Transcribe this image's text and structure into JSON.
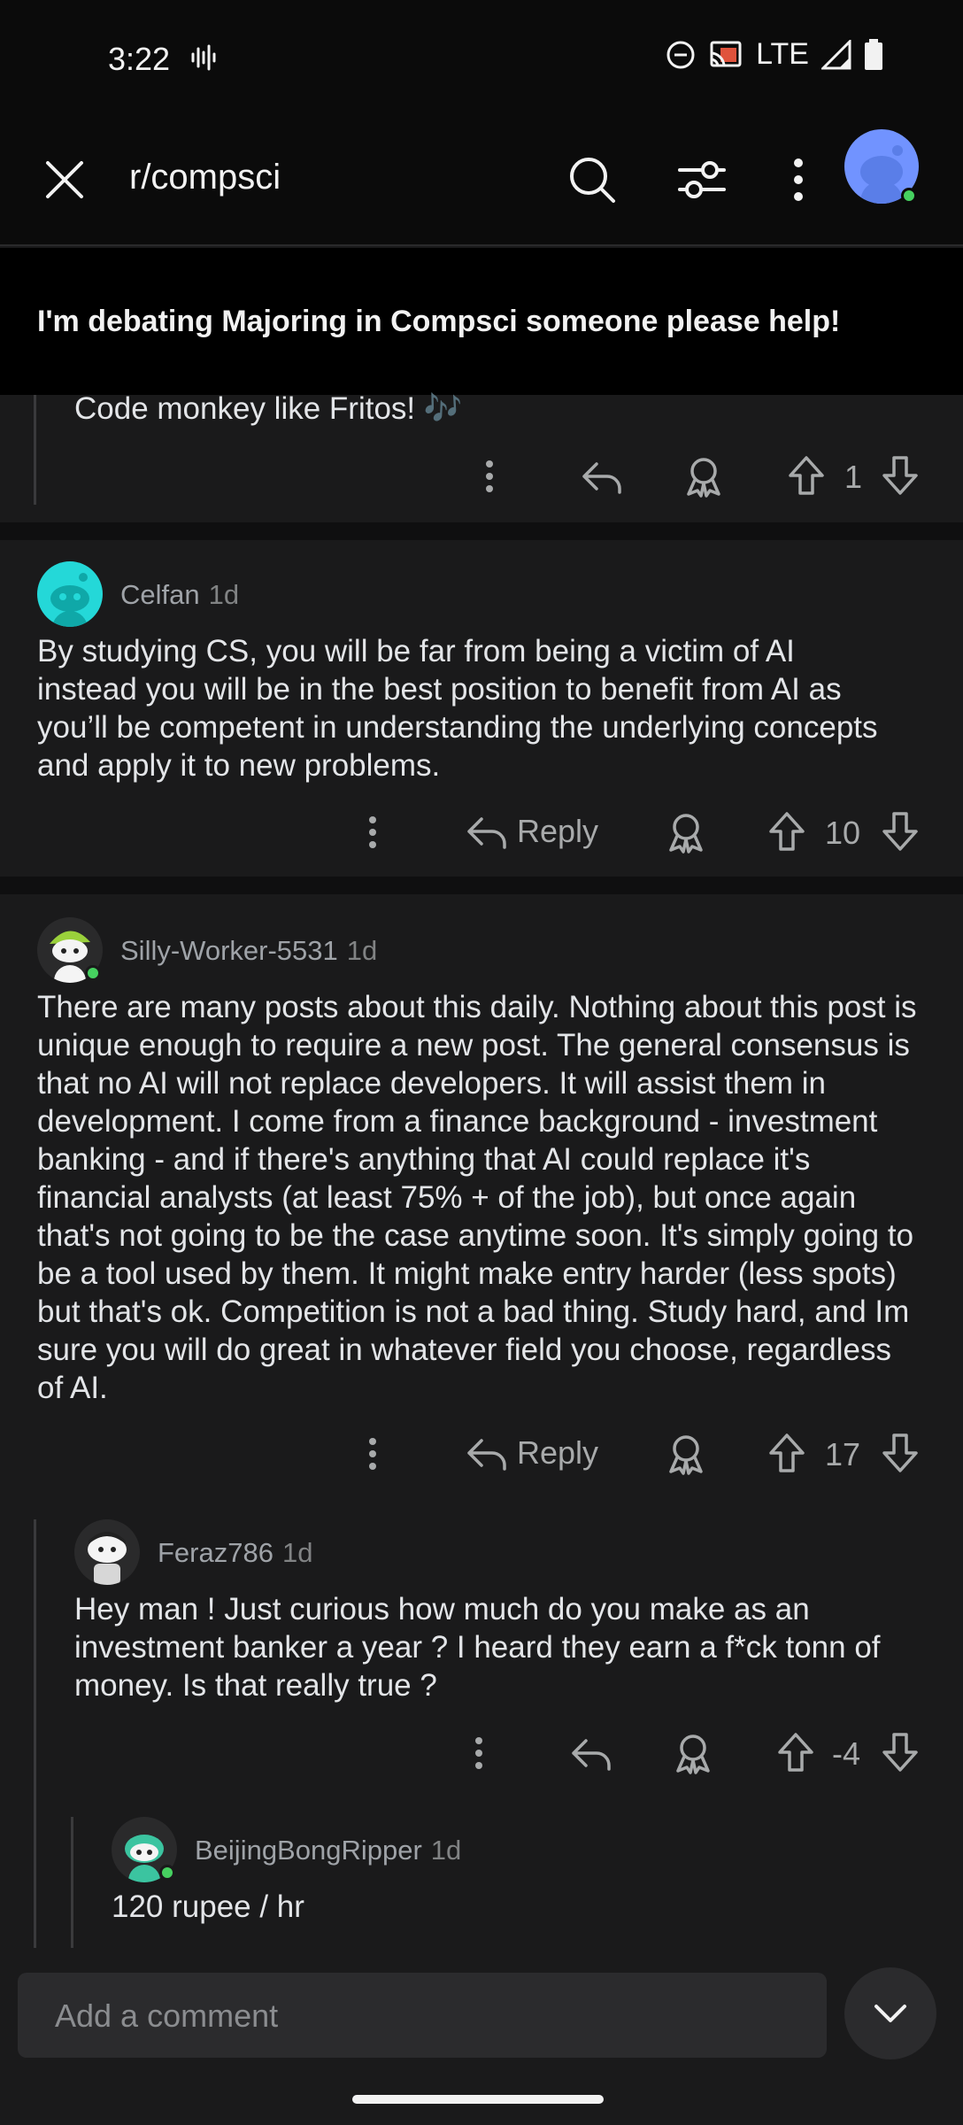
{
  "status_bar": {
    "time": "3:22",
    "network": "LTE"
  },
  "app_bar": {
    "title": "r/compsci"
  },
  "post": {
    "title": "I'm debating Majoring in Compsci someone please help!"
  },
  "comments": [
    {
      "body": "Code monkey like Fritos! 🎶",
      "votes": "1"
    },
    {
      "user": "Celfan",
      "age": "1d",
      "body": "By studying CS, you will be far from being a victim of AI instead you will be in the best position to benefit from AI as you’ll be competent in understanding the underlying concepts and apply it to new problems.",
      "reply_label": "Reply",
      "votes": "10"
    },
    {
      "user": "Silly-Worker-5531",
      "age": "1d",
      "body": "There are many posts about this daily. Nothing about this post is unique enough to require a new post. The general consensus is that no AI will not replace developers. It will assist them in development. I come from a finance background - investment banking - and if there's anything that AI could replace it's financial analysts (at least 75% + of the job), but once again that's not going to be the case anytime soon. It's simply going to be a tool used by them. It might make entry harder (less spots) but that's ok. Competition is not a bad thing. Study hard, and Im sure you will do great in whatever field you choose, regardless of AI.",
      "reply_label": "Reply",
      "votes": "17"
    },
    {
      "user": "Feraz786",
      "age": "1d",
      "body": "Hey man ! Just curious how much do you make as an investment banker a year ? I heard they earn a f*ck tonn of money. Is that really true ?",
      "votes": "-4"
    },
    {
      "user": "BeijingBongRipper",
      "age": "1d",
      "body": "120 rupee / hr"
    }
  ],
  "composer": {
    "placeholder": "Add a comment"
  },
  "colors": {
    "background": "#1a1a1b",
    "accent_avatar": "#7193ff",
    "online": "#46d160"
  }
}
